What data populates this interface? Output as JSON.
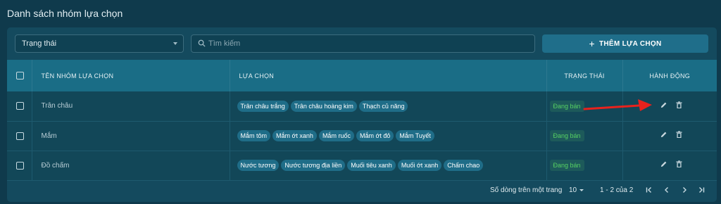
{
  "page": {
    "title": "Danh sách nhóm lựa chọn"
  },
  "toolbar": {
    "status_filter": "Trạng thái",
    "search_placeholder": "Tìm kiếm",
    "add_button": "THÊM LỰA CHỌN"
  },
  "table": {
    "headers": {
      "name": "TÊN NHÓM LỰA CHỌN",
      "options": "LỰA CHỌN",
      "status": "TRẠNG THÁI",
      "actions": "HÀNH ĐỘNG"
    },
    "rows": [
      {
        "name": "Trân châu",
        "options": [
          "Trân châu trắng",
          "Trân châu hoàng kim",
          "Thạch củ năng"
        ],
        "status": "Đang bán"
      },
      {
        "name": "Mắm",
        "options": [
          "Mắm tôm",
          "Mắm ớt xanh",
          "Mắm ruốc",
          "Mắm ớt đỏ",
          "Mắm Tuyết"
        ],
        "status": "Đang bán"
      },
      {
        "name": "Đồ chấm",
        "options": [
          "Nước tương",
          "Nước tương địa liền",
          "Muối tiêu xanh",
          "Muối ớt xanh",
          "Chấm chao"
        ],
        "status": "Đang bán"
      }
    ]
  },
  "pagination": {
    "rows_per_page_label": "Số dòng trên một trang",
    "rows_per_page": "10",
    "range": "1 - 2 của 2"
  },
  "colors": {
    "accent": "#1f6e8a",
    "status_green": "#56d163",
    "annotation_red": "#e8221d"
  },
  "icons": [
    "search-icon",
    "plus-icon",
    "pencil-icon",
    "trash-icon",
    "first-page-icon",
    "prev-page-icon",
    "next-page-icon",
    "last-page-icon",
    "red-arrow"
  ]
}
